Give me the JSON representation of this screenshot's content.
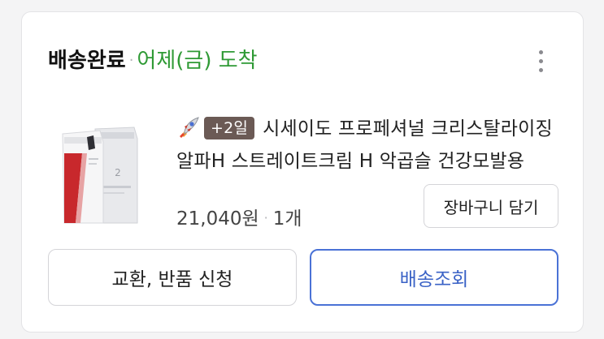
{
  "order": {
    "status": "배송완료",
    "separator": "·",
    "arrival": "어제(금) 도착",
    "more_icon": "more-vertical-icon"
  },
  "product": {
    "delivery_icon": "rocket-icon",
    "badge": "+2일",
    "title": "시세이도 프로페셔널 크리스탈라이징 알파H 스트레이트크림 H 악곱슬 건강모발용",
    "price": "21,040원",
    "separator": "·",
    "quantity": "1개",
    "image_label": "2"
  },
  "actions": {
    "add_to_cart": "장바구니 담기",
    "exchange_return": "교환, 반품 신청",
    "track_delivery": "배송조회"
  },
  "colors": {
    "arrival_green": "#2f9a35",
    "badge_brown": "#6b5a55",
    "tracking_blue": "#4a72d6"
  }
}
